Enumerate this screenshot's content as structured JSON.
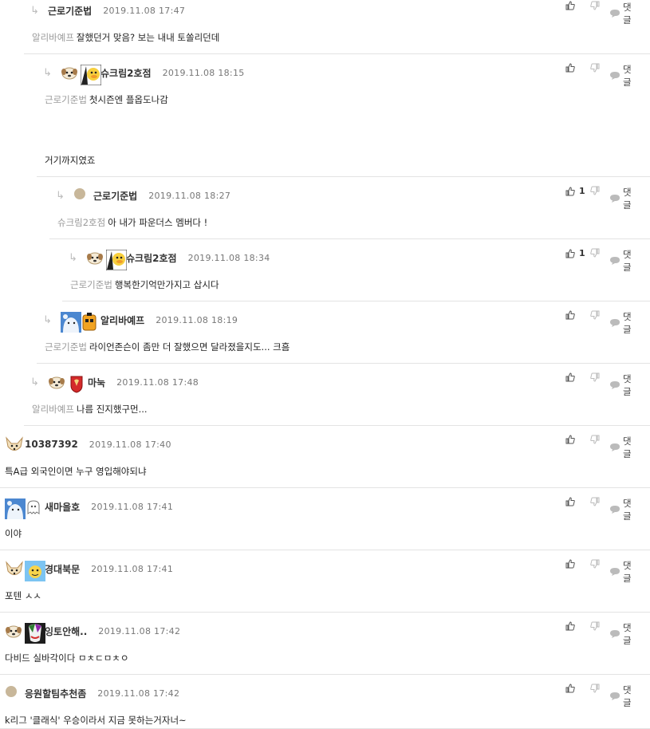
{
  "reply_label": "댓글",
  "comments": [
    {
      "nick": "근로기준법",
      "date": "2019.11.08 17:47",
      "mention": "알리바예프",
      "text": "잘했던거 맞음? 보는 내내 토쏠리던데",
      "like": ""
    },
    {
      "nick": "슈크림2호점",
      "date": "2019.11.08 18:15",
      "mention": "근로기준법",
      "text": "첫시즌엔 플옵도나감",
      "text2": "거기까지였죠",
      "like": ""
    },
    {
      "nick": "근로기준법",
      "date": "2019.11.08 18:27",
      "mention": "슈크림2호점",
      "text": "아 내가 파운더스 멤버다 !",
      "like": "1"
    },
    {
      "nick": "슈크림2호점",
      "date": "2019.11.08 18:34",
      "mention": "근로기준법",
      "text": "행복한기억만가지고 삽시다",
      "like": "1"
    },
    {
      "nick": "알리바예프",
      "date": "2019.11.08 18:19",
      "mention": "근로기준법",
      "text": "라이언존슨이 좀만 더 잘했으면 달라졌을지도... 크흠",
      "like": ""
    },
    {
      "nick": "마눅",
      "date": "2019.11.08 17:48",
      "mention": "알리바예프",
      "text": "나름 진지했구먼...",
      "like": ""
    },
    {
      "nick": "10387392",
      "date": "2019.11.08 17:40",
      "mention": "",
      "text": "특A급 외국인이면 누구 영입해야되냐",
      "like": ""
    },
    {
      "nick": "새마을호",
      "date": "2019.11.08 17:41",
      "mention": "",
      "text": "이야",
      "like": ""
    },
    {
      "nick": "경대북문",
      "date": "2019.11.08 17:41",
      "mention": "",
      "text": "포텐 ㅅㅅ",
      "like": ""
    },
    {
      "nick": "잉토안해..",
      "date": "2019.11.08 17:42",
      "mention": "",
      "text": "다비드 실바각이다 ㅁㅊㄷㅁㅊㅇ",
      "like": ""
    },
    {
      "nick": "응원할팀추천좀",
      "date": "2019.11.08 17:42",
      "mention": "",
      "text": "k리그 '클래식' 우승이라서 지금 못하는거자너~",
      "like": ""
    }
  ]
}
